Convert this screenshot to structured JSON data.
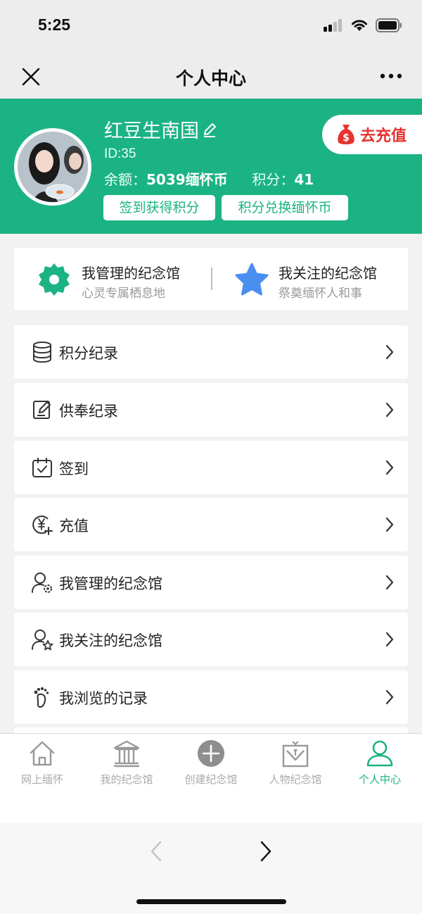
{
  "status_bar": {
    "time": "5:25"
  },
  "nav": {
    "title": "个人中心"
  },
  "profile": {
    "name": "红豆生南国",
    "id": "ID:35",
    "balance_label": "余额：",
    "balance_value": "5039缅怀币",
    "points_label": "积分：",
    "points_value": "41",
    "sign_button": "签到获得积分",
    "exchange_button": "积分兑换缅怀币",
    "recharge_button": "去充值"
  },
  "quick": [
    {
      "title": "我管理的纪念馆",
      "subtitle": "心灵专属栖息地",
      "icon": "gear-icon"
    },
    {
      "title": "我关注的纪念馆",
      "subtitle": "祭奠缅怀人和事",
      "icon": "star-icon"
    }
  ],
  "menu": [
    {
      "label": "积分纪录",
      "icon": "coins-icon"
    },
    {
      "label": "供奉纪录",
      "icon": "edit-note-icon"
    },
    {
      "label": "签到",
      "icon": "calendar-check-icon"
    },
    {
      "label": "充值",
      "icon": "yuan-add-icon"
    },
    {
      "label": "我管理的纪念馆",
      "icon": "user-gear-icon"
    },
    {
      "label": "我关注的纪念馆",
      "icon": "user-star-icon"
    },
    {
      "label": "我浏览的记录",
      "icon": "footprint-icon"
    }
  ],
  "tabs": [
    {
      "label": "网上缅怀",
      "icon": "house-icon",
      "active": false
    },
    {
      "label": "我的纪念馆",
      "icon": "temple-icon",
      "active": false
    },
    {
      "label": "创建纪念馆",
      "icon": "plus-circle-icon",
      "active": false
    },
    {
      "label": "人物纪念馆",
      "icon": "portrait-frame-icon",
      "active": false
    },
    {
      "label": "个人中心",
      "icon": "person-icon",
      "active": true
    }
  ],
  "colors": {
    "accent": "#1bb383",
    "recharge": "#e8322f",
    "tab_inactive": "#aaaaaa"
  }
}
